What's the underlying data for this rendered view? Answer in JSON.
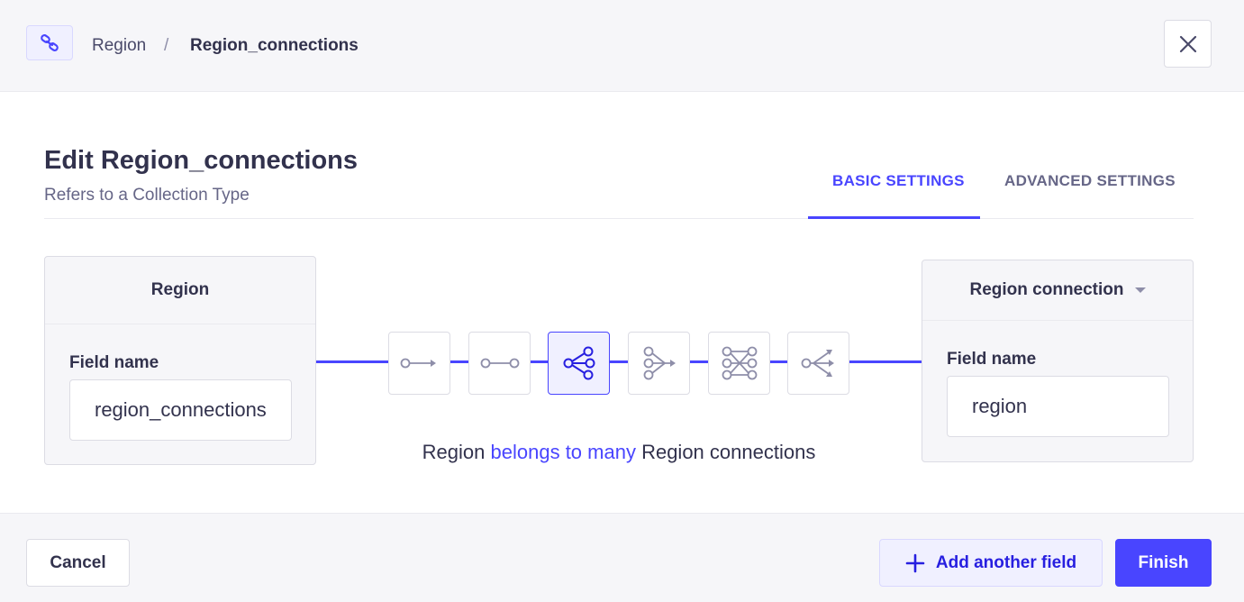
{
  "header": {
    "type_icon": "link-icon",
    "breadcrumb": [
      "Region",
      "/",
      "Region_connections"
    ],
    "close_icon": "close-icon"
  },
  "main": {
    "title": "Edit Region_connections",
    "subtitle": "Refers to a Collection Type",
    "tabs": [
      {
        "label": "BASIC SETTINGS",
        "active": true
      },
      {
        "label": "ADVANCED SETTINGS",
        "active": false
      }
    ]
  },
  "left_card": {
    "header": "Region",
    "field_label": "Field name",
    "field_value": "region_connections"
  },
  "right_card": {
    "header": "Region connection",
    "field_label": "Field name",
    "field_value": "region"
  },
  "relations": [
    {
      "icon": "one-way-icon",
      "active": false
    },
    {
      "icon": "one-to-one-icon",
      "active": false
    },
    {
      "icon": "one-to-many-icon",
      "active": true
    },
    {
      "icon": "many-to-one-icon",
      "active": false
    },
    {
      "icon": "many-to-many-icon",
      "active": false
    },
    {
      "icon": "many-way-icon",
      "active": false
    }
  ],
  "relation_sentence": {
    "subject": "Region",
    "verb": "belongs to many",
    "object": "Region connections"
  },
  "footer": {
    "cancel_label": "Cancel",
    "add_label": "Add another field",
    "finish_label": "Finish"
  },
  "colors": {
    "primary": "#4945ff",
    "primary_light": "#f0f0ff",
    "text": "#32324d",
    "muted": "#666687"
  }
}
